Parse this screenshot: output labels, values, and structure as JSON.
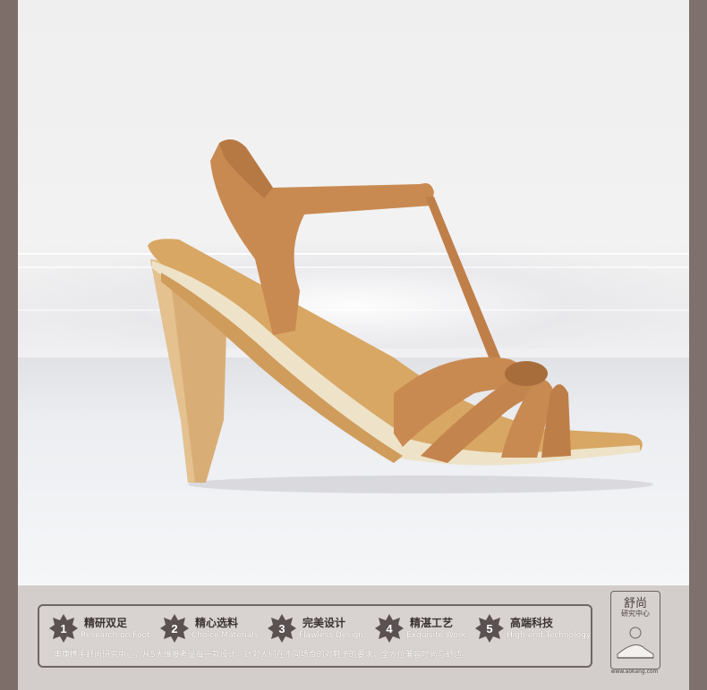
{
  "features": [
    {
      "number": "1",
      "cn": "精研双足",
      "en": "Research on Foot"
    },
    {
      "number": "2",
      "cn": "精心选料",
      "en": "Choice Materials"
    },
    {
      "number": "3",
      "cn": "完美设计",
      "en": "Flawless Design"
    },
    {
      "number": "4",
      "cn": "精湛工艺",
      "en": "Exquisite Work"
    },
    {
      "number": "5",
      "cn": "高端科技",
      "en": "High-end Technology"
    }
  ],
  "tagline": "奥康携手舒尚研究中心，从5大维度考量每一款设计。针对人们在不同场合的对鞋子的要求，全方位兼容时尚与舒适。",
  "brand": {
    "title": "舒尚",
    "subtitle": "研究中心",
    "url": "www.aokang.com",
    "logo_icon": "shoe-icon"
  },
  "product": {
    "image": "tan suede t-strap high-heel sandal",
    "colors": {
      "suede": "#c8894f",
      "patent": "#d7a96d",
      "trim": "#e9dcc0"
    }
  }
}
